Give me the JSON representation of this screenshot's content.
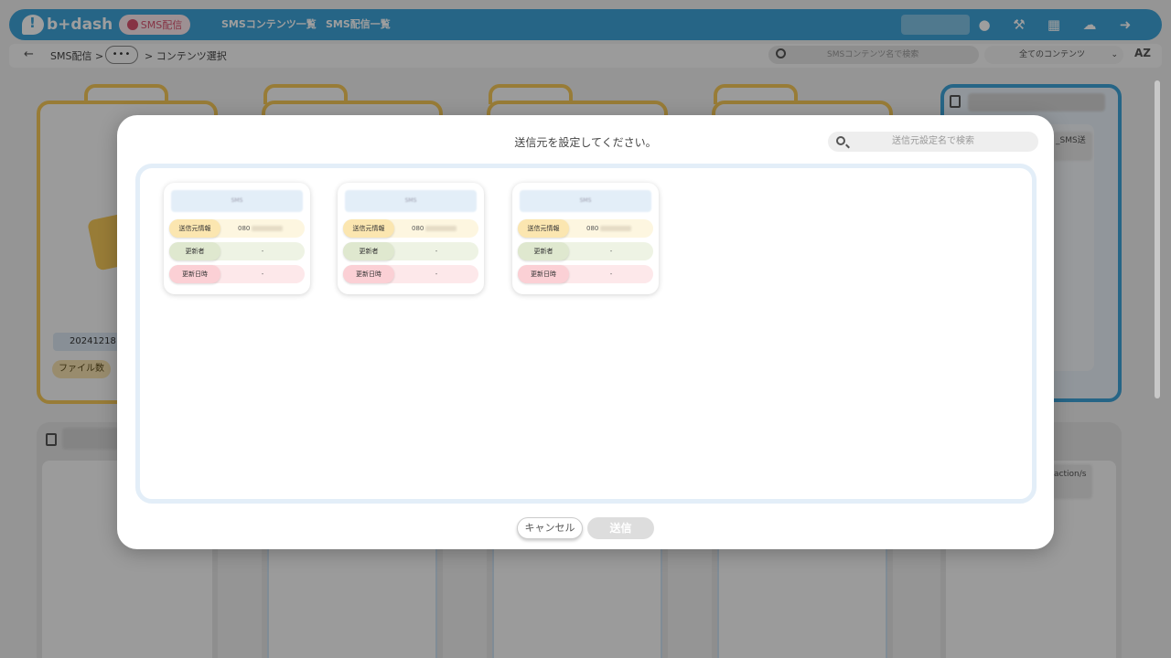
{
  "app": {
    "logo_text": "b+dash",
    "module_label": "SMS配信",
    "nav": [
      "SMSコンテンツ一覧",
      "SMS配信一覧"
    ],
    "icons": [
      "bell-icon",
      "wrench-icon",
      "grid-icon",
      "chat-icon",
      "logout-icon"
    ]
  },
  "breadcrumb": {
    "root": "SMS配信 >",
    "more": "•••",
    "current": "> コンテンツ選択",
    "search_placeholder": "SMSコンテンツ名で検索",
    "filter_value": "全てのコンテンツ",
    "sort_label": "AZ"
  },
  "background": {
    "folder_label": "20241218リ",
    "folder_chip": "ファイル数",
    "fragment_sms": "_SMS送",
    "fragment_action": "action/s"
  },
  "modal": {
    "title": "送信元を設定してください。",
    "search_placeholder": "送信元設定名で検索",
    "cancel_label": "キャンセル",
    "send_label": "送信"
  },
  "sender_labels": {
    "info": "送信元情報",
    "updater": "更新者",
    "updated_at": "更新日時"
  },
  "senders": [
    {
      "name": "SMS",
      "phone_prefix": "080",
      "updater": "-",
      "updated_at": "-"
    },
    {
      "name": "SMS",
      "phone_prefix": "080",
      "updater": "-",
      "updated_at": "-"
    },
    {
      "name": "SMS",
      "phone_prefix": "080",
      "updater": "-",
      "updated_at": "-"
    }
  ],
  "colors": {
    "brand": "#3ea3d9",
    "folder": "#f5c95a",
    "send_disabled": "#dddddd"
  }
}
